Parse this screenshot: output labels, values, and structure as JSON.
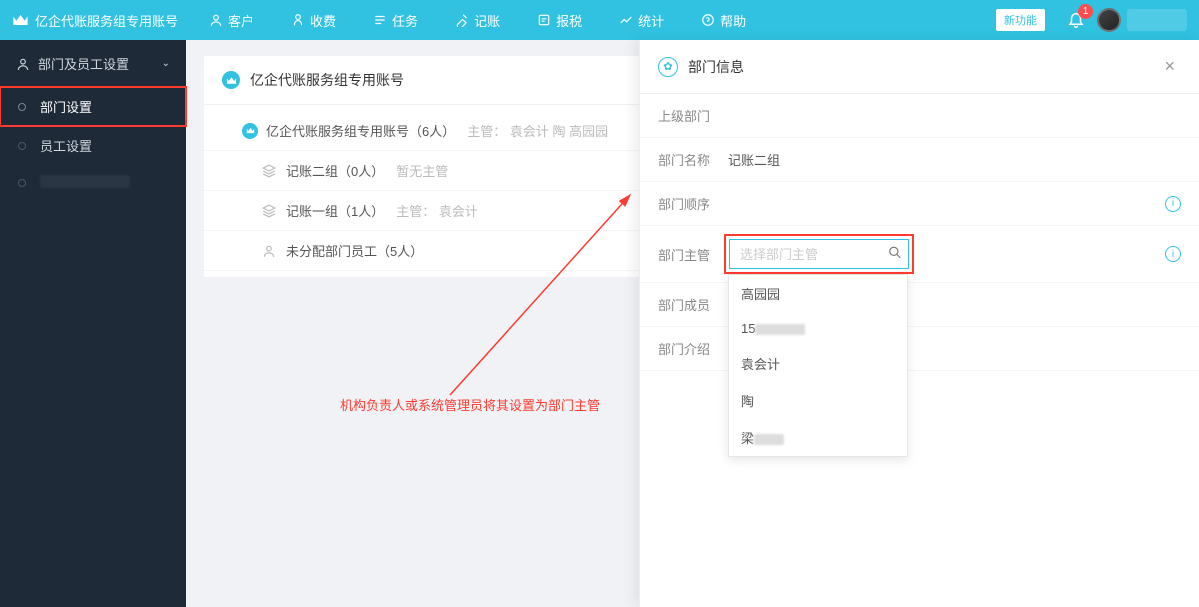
{
  "topnav": {
    "brand": "亿企代账服务组专用账号",
    "items": [
      {
        "icon": "customer",
        "label": "客户"
      },
      {
        "icon": "fee",
        "label": "收费"
      },
      {
        "icon": "task",
        "label": "任务"
      },
      {
        "icon": "ledger",
        "label": "记账"
      },
      {
        "icon": "tax",
        "label": "报税"
      },
      {
        "icon": "stats",
        "label": "统计"
      },
      {
        "icon": "help",
        "label": "帮助"
      }
    ],
    "new_badge": "新功能",
    "bell_count": "1"
  },
  "sidebar": {
    "group": "部门及员工设置",
    "items": [
      {
        "label": "部门设置",
        "active": true,
        "highlight": true
      },
      {
        "label": "员工设置"
      },
      {
        "label": "",
        "blurred": true
      }
    ]
  },
  "tree": {
    "title": "亿企代账服务组专用账号",
    "rows": [
      {
        "level": 1,
        "icon": "crown",
        "text": "亿企代账服务组专用账号（6人）",
        "meta": "主管： 袁会计 陶 高园园"
      },
      {
        "level": 2,
        "icon": "stack",
        "text": "记账二组（0人）",
        "meta": "暂无主管"
      },
      {
        "level": 2,
        "icon": "stack",
        "text": "记账一组（1人）",
        "meta": "主管： 袁会计"
      },
      {
        "level": 2,
        "icon": "person",
        "text": "未分配部门员工（5人）",
        "meta": ""
      }
    ]
  },
  "annotation": "机构负责人或系统管理员将其设置为部门主管",
  "panel": {
    "title": "部门信息",
    "fields": {
      "parent": {
        "label": "上级部门",
        "value": ""
      },
      "name": {
        "label": "部门名称",
        "value": "记账二组"
      },
      "order": {
        "label": "部门顺序",
        "value": ""
      },
      "supervisor": {
        "label": "部门主管",
        "placeholder": "选择部门主管"
      },
      "members": {
        "label": "部门成员",
        "value": ""
      },
      "intro": {
        "label": "部门介绍",
        "value": ""
      }
    },
    "dropdown": [
      "高园园",
      "15",
      "袁会计",
      "陶",
      "梁"
    ]
  }
}
